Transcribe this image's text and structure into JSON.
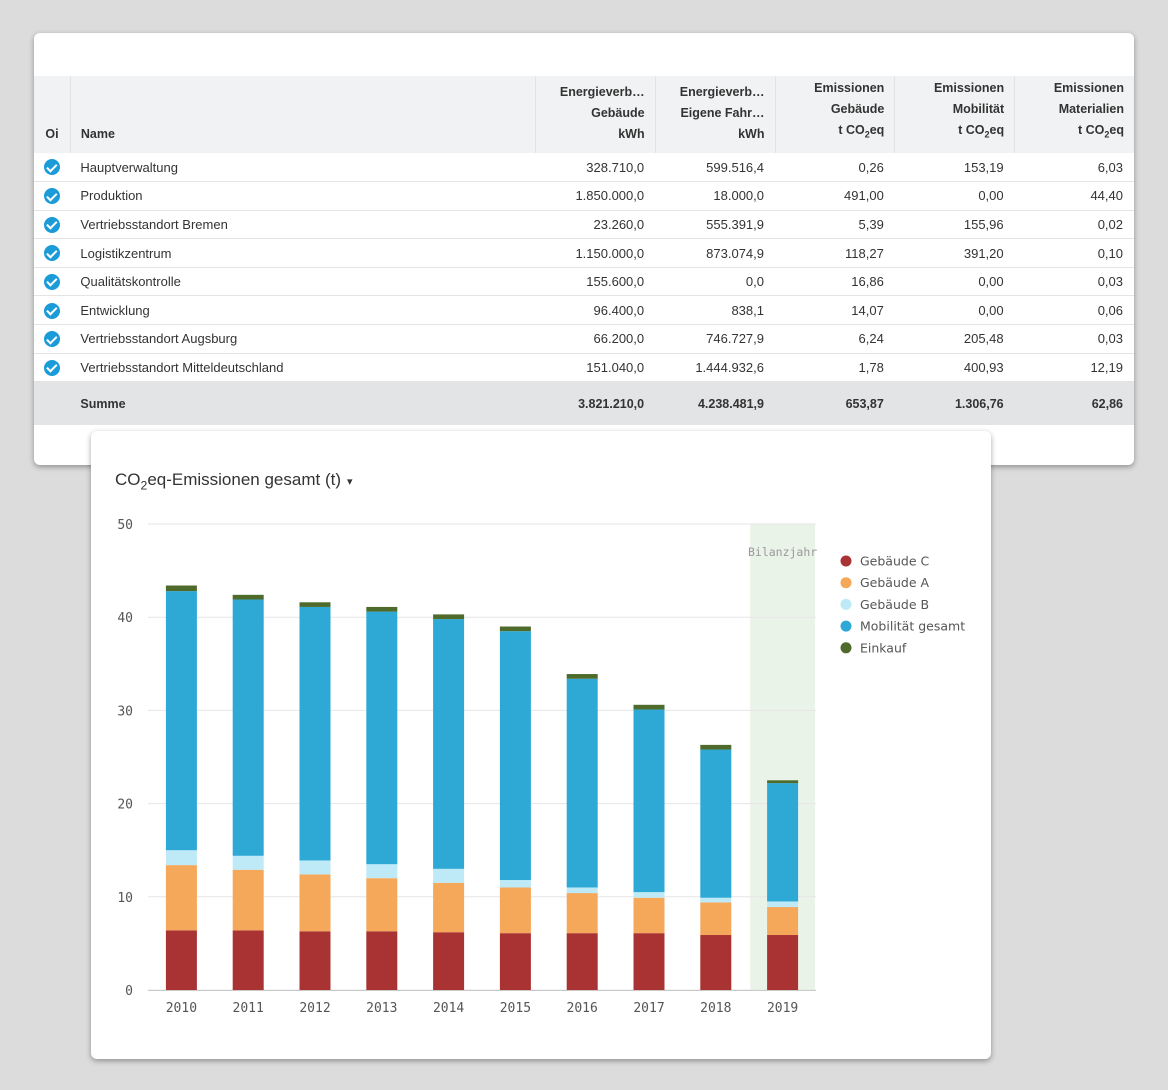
{
  "table": {
    "columns": [
      {
        "lines": [
          "Oi"
        ]
      },
      {
        "lines": [
          "Name"
        ]
      },
      {
        "lines": [
          "Energieverb…",
          "Gebäude",
          "kWh"
        ]
      },
      {
        "lines": [
          "Energieverb…",
          "Eigene Fahr…",
          "kWh"
        ]
      },
      {
        "lines": [
          "Emissionen",
          "Gebäude",
          "t CO₂eq"
        ]
      },
      {
        "lines": [
          "Emissionen",
          "Mobilität",
          "t CO₂eq"
        ]
      },
      {
        "lines": [
          "Emissionen",
          "Materialien",
          "t CO₂eq"
        ]
      }
    ],
    "rows": [
      {
        "name": "Hauptverwaltung",
        "values": [
          "328.710,0",
          "599.516,4",
          "0,26",
          "153,19",
          "6,03"
        ]
      },
      {
        "name": "Produktion",
        "values": [
          "1.850.000,0",
          "18.000,0",
          "491,00",
          "0,00",
          "44,40"
        ]
      },
      {
        "name": "Vertriebsstandort Bremen",
        "values": [
          "23.260,0",
          "555.391,9",
          "5,39",
          "155,96",
          "0,02"
        ]
      },
      {
        "name": "Logistikzentrum",
        "values": [
          "1.150.000,0",
          "873.074,9",
          "118,27",
          "391,20",
          "0,10"
        ]
      },
      {
        "name": "Qualitätskontrolle",
        "values": [
          "155.600,0",
          "0,0",
          "16,86",
          "0,00",
          "0,03"
        ]
      },
      {
        "name": "Entwicklung",
        "values": [
          "96.400,0",
          "838,1",
          "14,07",
          "0,00",
          "0,06"
        ]
      },
      {
        "name": "Vertriebsstandort Augsburg",
        "values": [
          "66.200,0",
          "746.727,9",
          "6,24",
          "205,48",
          "0,03"
        ]
      },
      {
        "name": "Vertriebsstandort Mitteldeutschland",
        "values": [
          "151.040,0",
          "1.444.932,6",
          "1,78",
          "400,93",
          "12,19"
        ]
      }
    ],
    "footer": {
      "label": "Summe",
      "values": [
        "3.821.210,0",
        "4.238.481,9",
        "653,87",
        "1.306,76",
        "62,86"
      ]
    }
  },
  "chart": {
    "title_prefix": "CO",
    "title_sub": "2",
    "title_suffix": "eq-Emissionen gesamt (t)",
    "caret": "▾",
    "highlight_label": "Bilanzjahr"
  },
  "colors": {
    "check": "#1b9bd8",
    "highlight_band": "#eaf3e8"
  },
  "chart_data": {
    "type": "bar",
    "stacked": true,
    "title": "CO2eq-Emissionen gesamt (t)",
    "categories": [
      "2010",
      "2011",
      "2012",
      "2013",
      "2014",
      "2015",
      "2016",
      "2017",
      "2018",
      "2019"
    ],
    "ylim": [
      0,
      50
    ],
    "yticks": [
      0,
      10,
      20,
      30,
      40,
      50
    ],
    "grid": true,
    "legend_position": "right",
    "highlight_category": "2019",
    "series": [
      {
        "name": "Gebäude C",
        "color": "#a93333",
        "values": [
          6.4,
          6.4,
          6.3,
          6.3,
          6.2,
          6.1,
          6.1,
          6.1,
          5.9,
          5.9
        ]
      },
      {
        "name": "Gebäude A",
        "color": "#f5a75a",
        "values": [
          7.0,
          6.5,
          6.1,
          5.7,
          5.3,
          4.9,
          4.3,
          3.8,
          3.5,
          3.0
        ]
      },
      {
        "name": "Gebäude B",
        "color": "#bdeaf6",
        "values": [
          1.6,
          1.5,
          1.5,
          1.5,
          1.5,
          0.8,
          0.6,
          0.6,
          0.5,
          0.6
        ]
      },
      {
        "name": "Mobilität gesamt",
        "color": "#2ea9d6",
        "values": [
          27.8,
          27.5,
          27.2,
          27.1,
          26.8,
          26.7,
          22.4,
          19.6,
          15.9,
          12.7
        ]
      },
      {
        "name": "Einkauf",
        "color": "#4e6b2c",
        "values": [
          0.6,
          0.5,
          0.5,
          0.5,
          0.5,
          0.5,
          0.5,
          0.5,
          0.5,
          0.3
        ]
      }
    ]
  }
}
